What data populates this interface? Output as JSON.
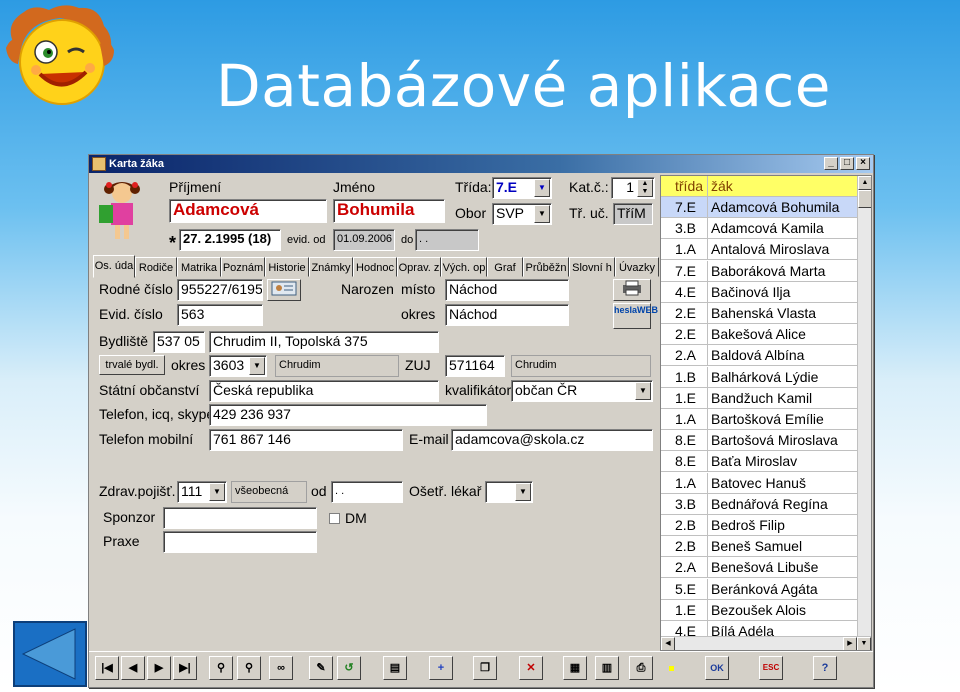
{
  "slide": {
    "title": "Databázové aplikace"
  },
  "window": {
    "title": "Karta žáka",
    "header": {
      "prijmeni_label": "Příjmení",
      "prijmeni": "Adamcová",
      "jmeno_label": "Jméno",
      "jmeno": "Bohumila",
      "trida_label": "Třída:",
      "trida": "7.E",
      "obor_label": "Obor",
      "obor": "SVP",
      "kat_label": "Kat.č.:",
      "kat": "1",
      "tr_uc_label": "Tř. uč.",
      "tr_uc": "TříM",
      "star": "*",
      "narozeni": "27. 2.1995 (18)",
      "evid_od_label": "evid. od",
      "evid_od": "01.09.2006",
      "do_label": "do",
      "do": ". ."
    },
    "tabs": [
      "Os. úda",
      "Rodiče",
      "Matrika",
      "Poznám",
      "Historie",
      "Známky",
      "Hodnoc",
      "Oprav. z",
      "Vých. op",
      "Graf",
      "Průběžn",
      "Slovní h",
      "Úvazky"
    ],
    "form": {
      "rodne_cislo_label": "Rodné číslo",
      "rodne_cislo": "955227/6195",
      "evid_cislo_label": "Evid. číslo",
      "evid_cislo": "563",
      "narozen_label": "Narozen",
      "misto_label": "místo",
      "misto": "Náchod",
      "okres_label": "okres",
      "okres": "Náchod",
      "heslo_web": "heslaWEB",
      "bydliste_label": "Bydliště",
      "psc": "537 05",
      "adresa": "Chrudim II, Topolská 375",
      "trvale_bydl": "trvalé bydl.",
      "okres2_label": "okres",
      "okres2_kod": "3603",
      "okres2": "Chrudim",
      "zuj_label": "ZUJ",
      "zuj": "571164",
      "zuj_nazev": "Chrudim",
      "obcanstvi_label": "Státní občanství",
      "obcanstvi": "Česká republika",
      "kvalifikator_label": "kvalifikátor",
      "kvalifikator": "občan ČR",
      "telefon_label": "Telefon, icq, skype",
      "telefon": "429 236 937",
      "mobil_label": "Telefon mobilní",
      "mobil": "761 867 146",
      "email_label": "E-mail",
      "email": "adamcova@skola.cz",
      "zdrav_label": "Zdrav.pojišť.",
      "zdrav": "111",
      "zdrav_nazev": "všeobecná",
      "od_label": "od",
      "od": ". .",
      "lekar_label": "Ošetř. lékař",
      "sponzor_label": "Sponzor",
      "dm_label": "DM",
      "praxe_label": "Praxe"
    },
    "list": {
      "header": {
        "trida": "třída",
        "zak": "žák"
      },
      "rows": [
        {
          "trida": "7.E",
          "zak": "Adamcová Bohumila"
        },
        {
          "trida": "3.B",
          "zak": "Adamcová Kamila"
        },
        {
          "trida": "1.A",
          "zak": "Antalová Miroslava"
        },
        {
          "trida": "7.E",
          "zak": "Baboráková Marta"
        },
        {
          "trida": "4.E",
          "zak": "Bačinová Ilja"
        },
        {
          "trida": "2.E",
          "zak": "Bahenská Vlasta"
        },
        {
          "trida": "2.E",
          "zak": "Bakešová Alice"
        },
        {
          "trida": "2.A",
          "zak": "Baldová Albína"
        },
        {
          "trida": "1.B",
          "zak": "Balhárková Lýdie"
        },
        {
          "trida": "1.E",
          "zak": "Bandžuch Kamil"
        },
        {
          "trida": "1.A",
          "zak": "Bartošková Emílie"
        },
        {
          "trida": "8.E",
          "zak": "Bartošová Miroslava"
        },
        {
          "trida": "8.E",
          "zak": "Baťa Miroslav"
        },
        {
          "trida": "1.A",
          "zak": "Batovec Hanuš"
        },
        {
          "trida": "3.B",
          "zak": "Bednářová Regína"
        },
        {
          "trida": "2.B",
          "zak": "Bedroš Filip"
        },
        {
          "trida": "2.B",
          "zak": "Beneš Samuel"
        },
        {
          "trida": "2.A",
          "zak": "Benešová Libuše"
        },
        {
          "trida": "5.E",
          "zak": "Beránková Agáta"
        },
        {
          "trida": "1.E",
          "zak": "Bezoušek Alois"
        },
        {
          "trida": "4.E",
          "zak": "Bílá Adéla"
        }
      ]
    },
    "toolbar": {
      "ok": "OK",
      "esc": "ESC",
      "help": "?"
    }
  }
}
